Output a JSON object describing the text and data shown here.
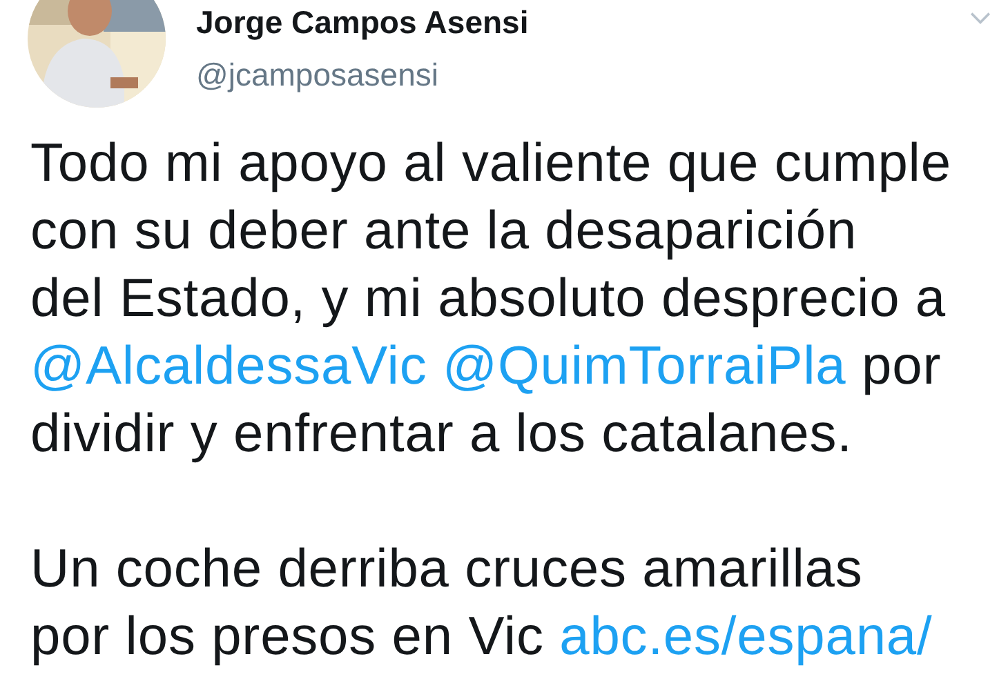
{
  "tweet": {
    "author": {
      "name": "Jorge Campos Asensi",
      "handle": "@jcamposasensi"
    },
    "paragraphs": [
      [
        [
          {
            "kind": "text",
            "text": "Todo mi apoyo al valiente que cumple"
          }
        ],
        [
          {
            "kind": "text",
            "text": "con su deber ante la desaparición"
          }
        ],
        [
          {
            "kind": "text",
            "text": "del Estado, y mi absoluto desprecio a"
          }
        ],
        [
          {
            "kind": "mention",
            "text": "@AlcaldessaVic"
          },
          {
            "kind": "mention",
            "text": "@QuimTorraiPla"
          },
          {
            "kind": "text",
            "text": " por"
          }
        ],
        [
          {
            "kind": "text",
            "text": "dividir y enfrentar a los catalanes."
          }
        ]
      ],
      [
        [
          {
            "kind": "text",
            "text": "Un coche derriba cruces amarillas"
          }
        ],
        [
          {
            "kind": "text",
            "text": "por los presos en Vic "
          },
          {
            "kind": "link",
            "text": "abc.es/espana/"
          }
        ]
      ]
    ]
  }
}
